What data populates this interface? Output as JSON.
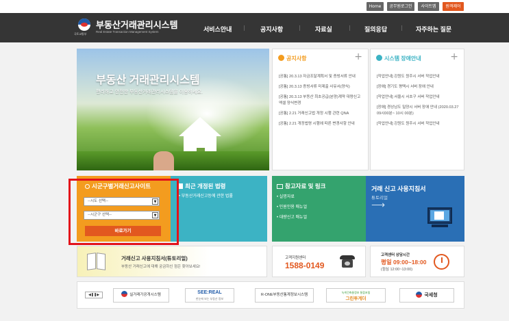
{
  "utility": {
    "home": "Home",
    "login": "공무원로그인",
    "sitemap": "사이트맵",
    "wrong": "원격제어"
  },
  "header": {
    "logo_sub": "국토교통부",
    "title": "부동산거래관리시스템",
    "title_en": "Real Estate Transaction Management System",
    "nav": [
      "서비스안내",
      "공지사항",
      "자료실",
      "질의응답",
      "자주하는 질문"
    ]
  },
  "hero": {
    "title": "부동산 거래관리시스템",
    "subtitle": "편리하고 안전한 부동산거래관리시스템을 이용하세요."
  },
  "notice": {
    "title": "공지사항",
    "plus": "+",
    "items": [
      "[공통] 20.3.13 자금조달계획서 및 증빙서류 안내",
      "[공통] 20.3.13 증빙서류 미제출 사유서(양식)",
      "[공통] 20.3.13 부동산 최초공급(분양)계약 대량신고 엑셀 양식변경",
      "[공통] 2.21 거래신고법 개정 시행 관련 QNA",
      "[공통] 2.21 개정법령 시행에 따른 변경사항 안내"
    ]
  },
  "system": {
    "title": "시스템 장애안내",
    "plus": "+",
    "items": [
      "[작업안내] 강원도 원주시 서버 작업안내",
      "[장애] 경기도 평택시 서버 장애 안내",
      "[작업안내] 서울시 서초구 서버 작업안내",
      "[장애] 경상남도 밀양시 서버 장애 안내 (2020.03.27 09시00분~ 10시 00분)",
      "[작업안내] 강원도 원주시 서버 작업안내"
    ]
  },
  "local": {
    "title": "시군구별거래신고사이트",
    "sido": "--시도 선택--",
    "sigungu": "--시군구 선택--",
    "go": "바로가기",
    "arrow": "▼"
  },
  "law": {
    "title": "최근 개정된 법령",
    "item": "부동산거래신고등에 관한 법률"
  },
  "refs": {
    "title": "참고자료 및 링크",
    "items": [
      "실명자료",
      "민원인용 매뉴얼",
      "대량신고 매뉴얼"
    ]
  },
  "guide": {
    "title": "거래 신고 사용지침서",
    "link": "튜토리얼",
    "arrow": "⟶"
  },
  "tutorial": {
    "title": "거래신고 사용지침서(튜토리얼)",
    "desc": "부동산 거래신고에 대해 궁금하신 점은 찾아보세요!"
  },
  "callcenter": {
    "label": "고객지원센터",
    "phone": "1588-0149"
  },
  "hours": {
    "label": "고객센터 상담시간",
    "time": "평일 09:00~18:00",
    "lunch": "(점심 12:00~13:00)"
  },
  "partners": {
    "items": [
      "실거래가공개시스템",
      "SEE:REAL",
      "R-ONE부동산통계정보시스템",
      "그린투게더",
      "국세청"
    ],
    "seereal_sub": "한눈에 보는 부동산 정보",
    "green_sub": "녹색건축물정보 통합포털"
  },
  "colors": {
    "orange": "#f39c1f",
    "teal": "#3cb3c4",
    "green": "#34a36e",
    "blue": "#2a6fb5",
    "red_highlight": "#e3121a",
    "header_bg": "#353535"
  }
}
